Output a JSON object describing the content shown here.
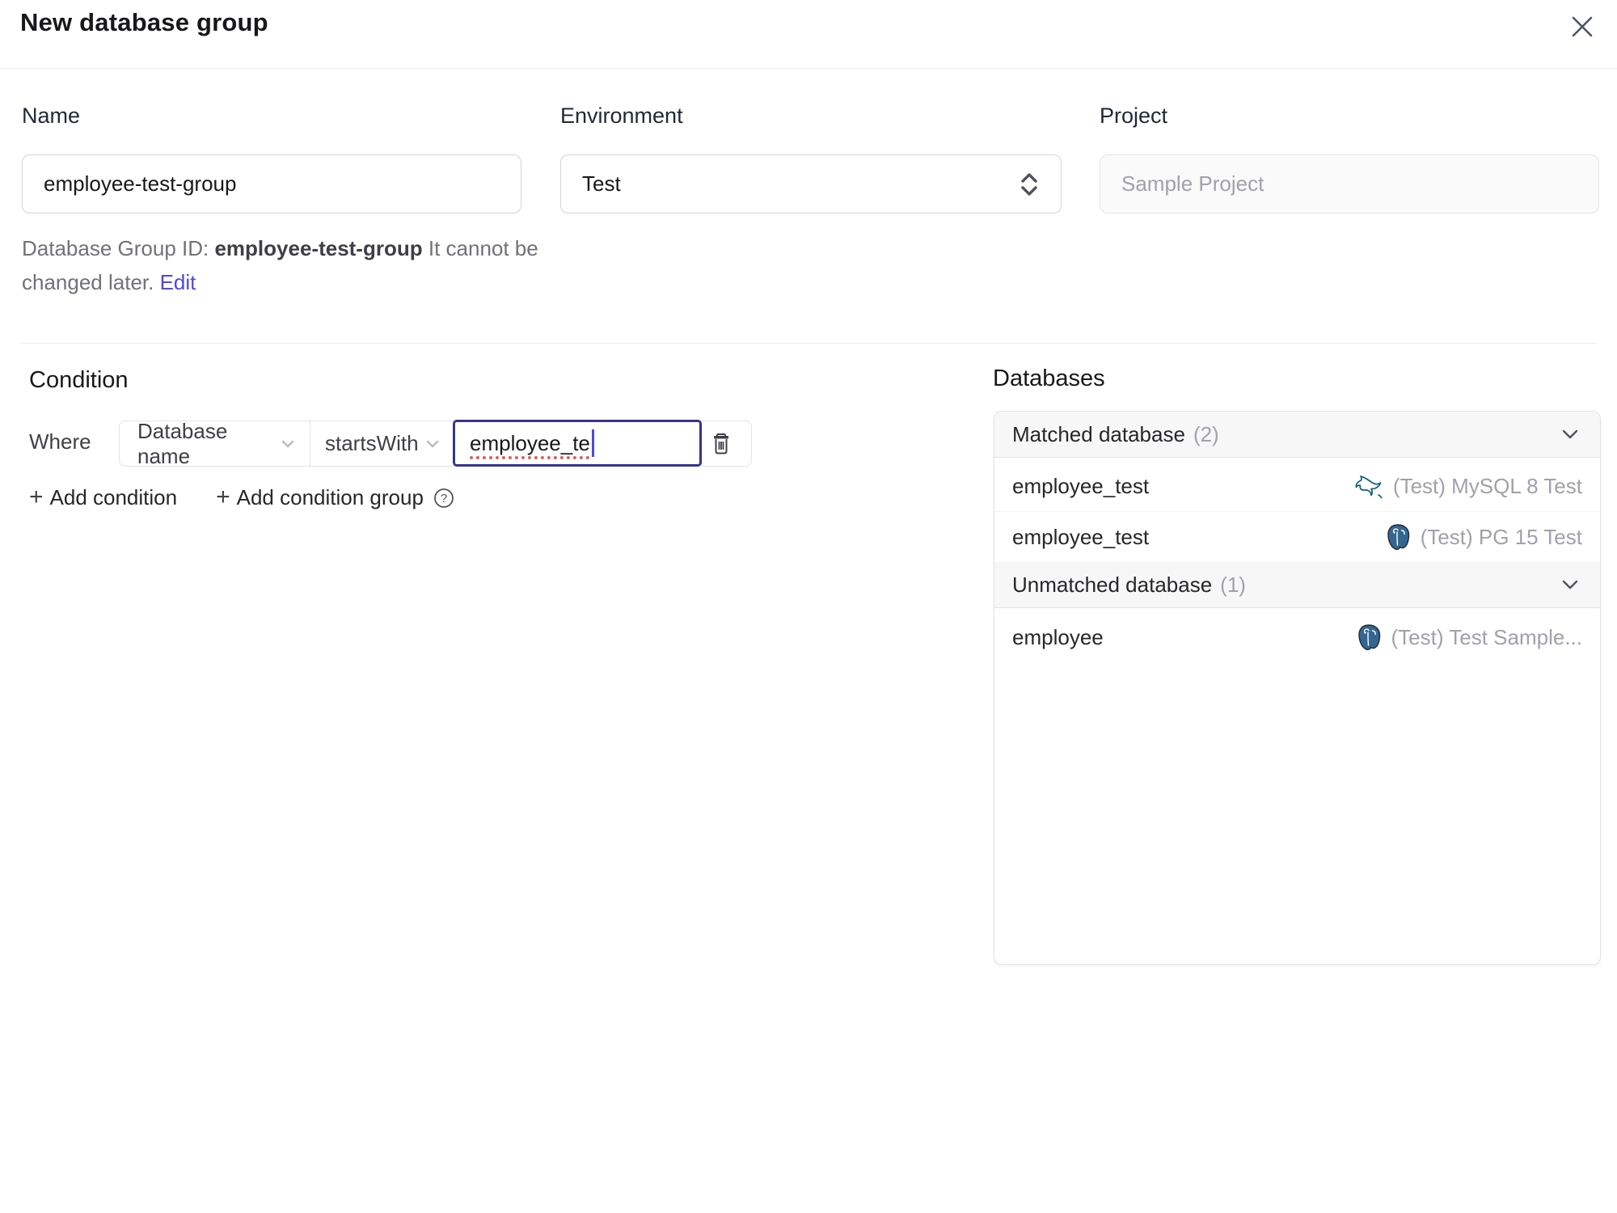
{
  "dialog": {
    "title": "New database group"
  },
  "form": {
    "name": {
      "label": "Name",
      "value": "employee-test-group"
    },
    "environment": {
      "label": "Environment",
      "value": "Test"
    },
    "project": {
      "label": "Project",
      "value": "Sample Project"
    },
    "group_id_help": {
      "prefix": "Database Group ID: ",
      "id": "employee-test-group",
      "suffix": " It cannot be changed later. ",
      "edit_link": "Edit"
    }
  },
  "condition": {
    "heading": "Condition",
    "where_label": "Where",
    "field_selected": "Database name",
    "operator_selected": "startsWith",
    "value": "employee_te",
    "plus_sign": "+",
    "add_condition_label": "Add condition",
    "add_condition_group_label": "Add condition group"
  },
  "databases": {
    "heading": "Databases",
    "sections": [
      {
        "title": "Matched database",
        "count": "(2)",
        "rows": [
          {
            "name": "employee_test",
            "engine_icon": "mysql-icon",
            "instance": "(Test) MySQL 8 Test"
          },
          {
            "name": "employee_test",
            "engine_icon": "postgres-icon",
            "instance": "(Test) PG 15 Test"
          }
        ]
      },
      {
        "title": "Unmatched database",
        "count": "(1)",
        "rows": [
          {
            "name": "employee",
            "engine_icon": "postgres-icon",
            "instance": "(Test) Test Sample..."
          }
        ]
      }
    ]
  },
  "colors": {
    "accent": "#4f46e5",
    "focus_border": "#39338f",
    "spellcheck_underline": "#e25c5c",
    "border": "#e4e4e7",
    "muted_text": "#a1a1aa",
    "header_bg": "#f7f7f8",
    "mysql": "#0f5e77",
    "postgres": "#336791"
  }
}
